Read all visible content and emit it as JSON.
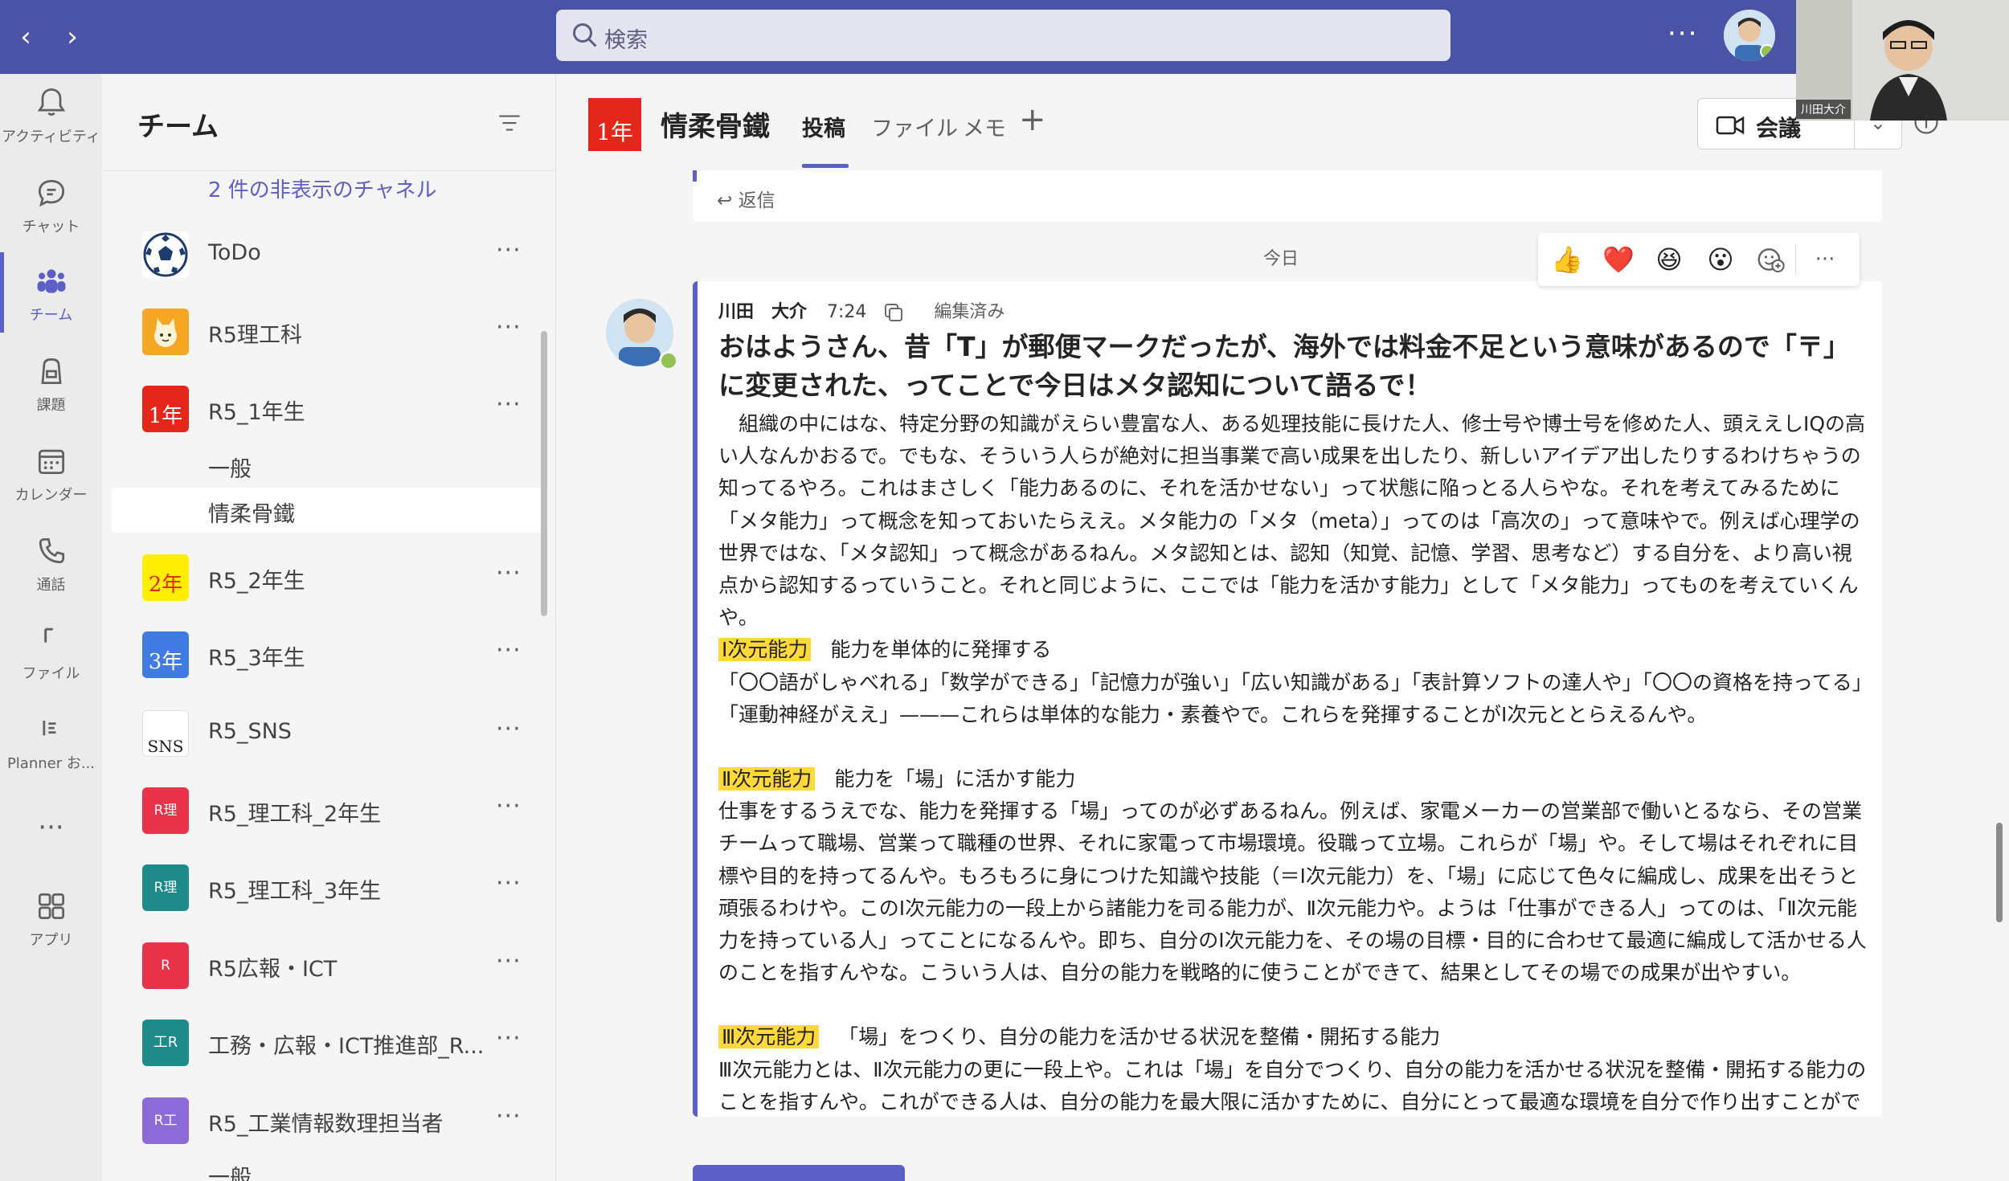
{
  "search": {
    "placeholder": "検索"
  },
  "video": {
    "name": "川田大介"
  },
  "rail": [
    {
      "label": "アクティビティ",
      "icon": "bell-icon"
    },
    {
      "label": "チャット",
      "icon": "chat-icon"
    },
    {
      "label": "チーム",
      "icon": "teams-icon"
    },
    {
      "label": "課題",
      "icon": "backpack-icon"
    },
    {
      "label": "カレンダー",
      "icon": "calendar-icon"
    },
    {
      "label": "通話",
      "icon": "phone-icon"
    },
    {
      "label": "ファイル",
      "icon": "file-icon"
    },
    {
      "label": "Planner お...",
      "icon": "planner-icon"
    },
    {
      "label": "アプリ",
      "icon": "apps-icon"
    }
  ],
  "panel": {
    "title": "チーム",
    "hidden_channels": "2 件の非表示のチャネル",
    "teams": [
      {
        "name": "ToDo",
        "tile": "⚽",
        "color": "#ffffff"
      },
      {
        "name": "R5理工科",
        "tile": "😺",
        "color": "#f5a623"
      },
      {
        "name": "R5_1年生",
        "tile": "1年",
        "color": "#e5261a"
      },
      {
        "name": "R5_2年生",
        "tile": "2年",
        "color": "#ffee00"
      },
      {
        "name": "R5_3年生",
        "tile": "3年",
        "color": "#3f7be0"
      },
      {
        "name": "R5_SNS",
        "tile": "SNS",
        "color": "#ffffff"
      },
      {
        "name": "R5_理工科_2年生",
        "tile": "R理",
        "color": "#e8334a"
      },
      {
        "name": "R5_理工科_3年生",
        "tile": "R理",
        "color": "#1e8a8a"
      },
      {
        "name": "R5広報・ICT",
        "tile": "R",
        "color": "#e8334a"
      },
      {
        "name": "工務・広報・ICT推進部_R...",
        "tile": "工R",
        "color": "#1e8a8a"
      },
      {
        "name": "R5_工業情報数理担当者",
        "tile": "R工",
        "color": "#8c6bd9"
      }
    ],
    "channels_r5_1": [
      "一般",
      "情柔骨鐵"
    ],
    "channel_last": "一般"
  },
  "channel": {
    "tile": "1年",
    "title": "情柔骨鐵",
    "tabs": [
      "投稿",
      "ファイル",
      "メモ"
    ],
    "meet_label": "会議"
  },
  "prev_reply": "返信",
  "date_divider": "今日",
  "message": {
    "author": "川田　大介",
    "time": "7:24",
    "edited": "編集済み",
    "subject": "おはようさん、昔「T」が郵便マークだったが、海外では料金不足という意味があるので「〒」に変更された、ってことで今日はメタ認知について語るで！",
    "p1": "　組織の中にはな、特定分野の知識がえらい豊富な人、ある処理技能に長けた人、修士号や博士号を修めた人、頭ええしIQの高い人なんかおるで。でもな、そういう人らが絶対に担当事業で高い成果を出したり、新しいアイデア出したりするわけちゃうの知ってるやろ。これはまさしく「能力あるのに、それを活かせない」って状態に陥っとる人らやな。それを考えてみるために「メタ能力」って概念を知っておいたらええ。メタ能力の「メタ（meta）」ってのは「高次の」って意味やで。例えば心理学の世界ではな、「メタ認知」って概念があるねん。メタ認知とは、認知（知覚、記憶、学習、思考など）する自分を、より高い視点から認知するっていうこと。それと同じように、ここでは「能力を活かす能力」として「メタ能力」ってものを考えていくんや。",
    "h1": "Ⅰ次元能力",
    "h1_desc": "能力を単体的に発揮する",
    "p2": "「〇〇語がしゃべれる」「数学ができる」「記憶力が強い」「広い知識がある」「表計算ソフトの達人や」「〇〇の資格を持ってる」「運動神経がええ」———これらは単体的な能力・素養やで。これらを発揮することがⅠ次元ととらえるんや。",
    "h2": "Ⅱ次元能力",
    "h2_desc": "能力を「場」に活かす能力",
    "p3": "仕事をするうえでな、能力を発揮する「場」ってのが必ずあるねん。例えば、家電メーカーの営業部で働いとるなら、その営業チームって職場、営業って職種の世界、それに家電って市場環境。役職って立場。これらが「場」や。そして場はそれぞれに目標や目的を持ってるんや。もろもろに身につけた知識や技能（＝Ⅰ次元能力）を、「場」に応じて色々に編成し、成果を出そうと頑張るわけや。このⅠ次元能力の一段上から諸能力を司る能力が、Ⅱ次元能力や。ようは「仕事ができる人」ってのは、「Ⅱ次元能力を持っている人」ってことになるんや。即ち、自分のⅠ次元能力を、その場の目標・目的に合わせて最適に編成して活かせる人のことを指すんやな。こういう人は、自分の能力を戦略的に使うことができて、結果としてその場での成果が出やすい。",
    "h3": "Ⅲ次元能力",
    "h3_desc": "「場」をつくり、自分の能力を活かせる状況を整備・開拓する能力",
    "p4": "Ⅲ次元能力とは、Ⅱ次元能力の更に一段上や。これは「場」を自分でつくり、自分の能力を活かせる状況を整備・開拓する能力のことを指すんや。これができる人は、自分の能力を最大限に活かすために、自分にとって最適な環境を自分で作り出すことができるんや。このような人は、新たなチャンスを自分で創出したり、自分にとって都合の良い状況を作り出すことができるから、成功する"
  },
  "reactions": [
    "👍",
    "❤️",
    "😆",
    "😮"
  ],
  "colors": {
    "brand": "#4b53a6",
    "accent": "#5b5fc7",
    "highlight": "#ffd83c"
  }
}
